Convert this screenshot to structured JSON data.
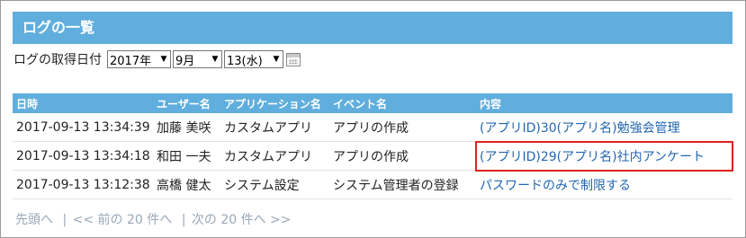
{
  "title": "ログの一覧",
  "date_filter": {
    "label": "ログの取得日付",
    "year": "2017年",
    "month": "9月",
    "day": "13(水)"
  },
  "table": {
    "headers": [
      "日時",
      "ユーザー名",
      "アプリケーション名",
      "イベント名",
      "内容"
    ],
    "rows": [
      {
        "datetime": "2017-09-13 13:34:39",
        "user": "加藤 美咲",
        "app": "カスタムアプリ",
        "event": "アプリの作成",
        "content": "(アプリID)30(アプリ名)勉強会管理"
      },
      {
        "datetime": "2017-09-13 13:34:18",
        "user": "和田 一夫",
        "app": "カスタムアプリ",
        "event": "アプリの作成",
        "content": "(アプリID)29(アプリ名)社内アンケート"
      },
      {
        "datetime": "2017-09-13 13:12:38",
        "user": "高橋 健太",
        "app": "システム設定",
        "event": "システム管理者の登録",
        "content": "パスワードのみで制限する"
      }
    ]
  },
  "pager": {
    "first": "先頭へ",
    "prev": "<< 前の 20 件へ",
    "next": "次の 20 件へ >>"
  },
  "colors": {
    "header_bg": "#5faedd",
    "link": "#2367b0",
    "highlight": "#e02020"
  }
}
